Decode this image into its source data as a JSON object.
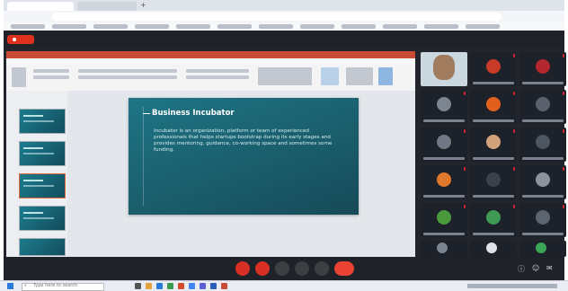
{
  "meeting": {
    "title": "",
    "clock": ""
  },
  "slide": {
    "title": "Business Incubator",
    "body": "Incubator is an organization, platform or team of experienced professionals that helps startups bootstrap during its early stages and provides mentoring, guidance, co-working space and sometimes some funding."
  },
  "taskbar": {
    "search_placeholder": "Type here to search"
  },
  "colors": {
    "slide_bg": "#1a5e6d",
    "ppt_accent": "#c94d36",
    "leave_red": "#e0311e",
    "meet_bg": "#22262c"
  },
  "participants_count": 15,
  "icons": [
    "search-icon",
    "windows-logo-icon",
    "mic-icon",
    "camera-icon",
    "present-icon",
    "reactions-icon",
    "more-icon",
    "leave-call-icon",
    "people-icon",
    "chat-icon"
  ]
}
